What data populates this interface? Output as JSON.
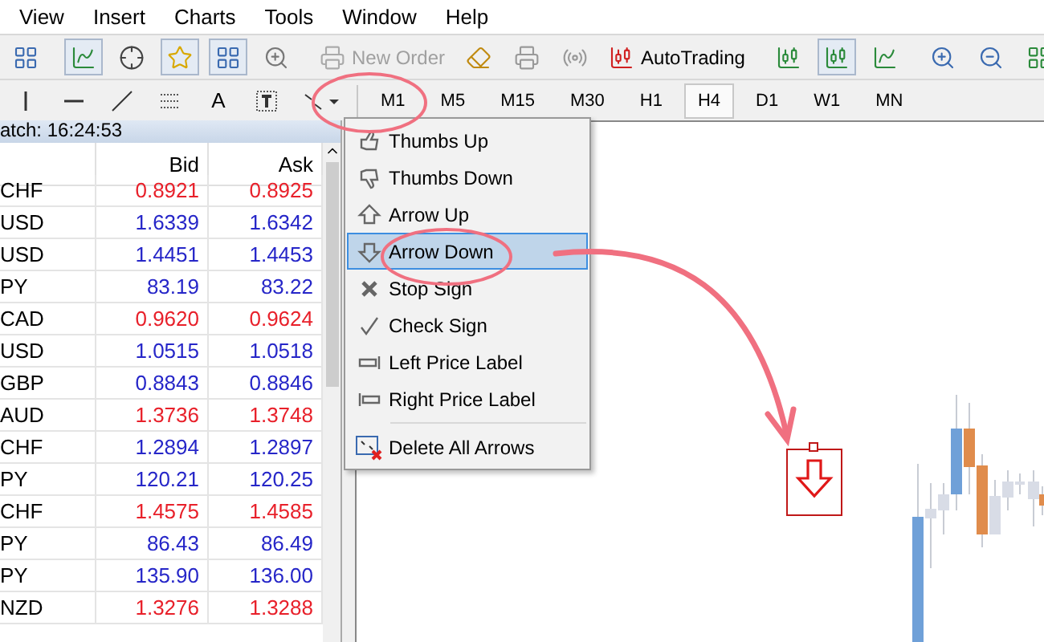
{
  "menu": [
    "View",
    "Insert",
    "Charts",
    "Tools",
    "Window",
    "Help"
  ],
  "toolbar": {
    "new_order": {
      "label": "New Order",
      "disabled": true
    },
    "auto_trading": {
      "label": "AutoTrading"
    }
  },
  "drawing_toolbar": {
    "text_tool": "A",
    "timeframes": [
      {
        "label": "M1",
        "selected": false
      },
      {
        "label": "M5",
        "selected": false
      },
      {
        "label": "M15",
        "selected": false
      },
      {
        "label": "M30",
        "selected": false
      },
      {
        "label": "H1",
        "selected": false
      },
      {
        "label": "H4",
        "selected": true
      },
      {
        "label": "D1",
        "selected": false
      },
      {
        "label": "W1",
        "selected": false
      },
      {
        "label": "MN",
        "selected": false
      }
    ]
  },
  "market_watch": {
    "title": "atch: 16:24:53",
    "columns": [
      "Bid",
      "Ask"
    ],
    "rows": [
      {
        "symbol": "CHF",
        "bid": "0.8921",
        "ask": "0.8925",
        "color": "#e8202a"
      },
      {
        "symbol": "USD",
        "bid": "1.6339",
        "ask": "1.6342",
        "color": "#2626c8"
      },
      {
        "symbol": "USD",
        "bid": "1.4451",
        "ask": "1.4453",
        "color": "#2626c8"
      },
      {
        "symbol": "PY",
        "bid": "83.19",
        "ask": "83.22",
        "color": "#2626c8"
      },
      {
        "symbol": "CAD",
        "bid": "0.9620",
        "ask": "0.9624",
        "color": "#e8202a"
      },
      {
        "symbol": "USD",
        "bid": "1.0515",
        "ask": "1.0518",
        "color": "#2626c8"
      },
      {
        "symbol": "GBP",
        "bid": "0.8843",
        "ask": "0.8846",
        "color": "#2626c8"
      },
      {
        "symbol": "AUD",
        "bid": "1.3736",
        "ask": "1.3748",
        "color": "#e8202a"
      },
      {
        "symbol": "CHF",
        "bid": "1.2894",
        "ask": "1.2897",
        "color": "#2626c8"
      },
      {
        "symbol": "PY",
        "bid": "120.21",
        "ask": "120.25",
        "color": "#2626c8"
      },
      {
        "symbol": "CHF",
        "bid": "1.4575",
        "ask": "1.4585",
        "color": "#e8202a"
      },
      {
        "symbol": "PY",
        "bid": "86.43",
        "ask": "86.49",
        "color": "#2626c8"
      },
      {
        "symbol": "PY",
        "bid": "135.90",
        "ask": "136.00",
        "color": "#2626c8"
      },
      {
        "symbol": "NZD",
        "bid": "1.3276",
        "ask": "1.3288",
        "color": "#e8202a"
      }
    ]
  },
  "arrows_menu": {
    "items": [
      {
        "label": "Thumbs Up",
        "kind": "thumbs_up",
        "selected": false
      },
      {
        "label": "Thumbs Down",
        "kind": "thumbs_down",
        "selected": false
      },
      {
        "label": "Arrow Up",
        "kind": "arrow_up",
        "selected": false
      },
      {
        "label": "Arrow Down",
        "kind": "arrow_down",
        "selected": true
      },
      {
        "label": "Stop Sign",
        "kind": "stop",
        "selected": false
      },
      {
        "label": "Check Sign",
        "kind": "check",
        "selected": false
      },
      {
        "label": "Left Price Label",
        "kind": "left_label",
        "selected": false
      },
      {
        "label": "Right Price Label",
        "kind": "right_label",
        "selected": false
      },
      {
        "label": "Delete All Arrows",
        "kind": "delete",
        "selected": false
      }
    ]
  }
}
